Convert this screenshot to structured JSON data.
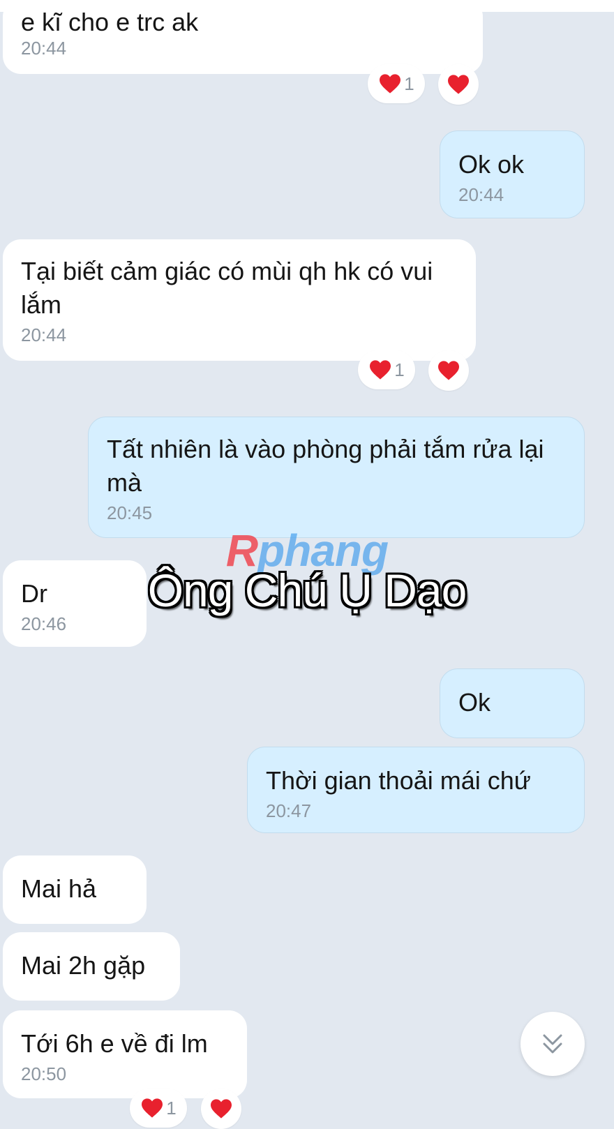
{
  "messages": [
    {
      "text": "e kĩ cho e trc ak",
      "time": "20:44"
    },
    {
      "text": "Ok ok",
      "time": "20:44"
    },
    {
      "text": "Tại biết cảm giác có mùi qh hk có vui lắm",
      "time": "20:44"
    },
    {
      "text": "Tất nhiên là vào phòng phải tắm rửa lại mà",
      "time": "20:45"
    },
    {
      "text": "Dr",
      "time": "20:46"
    },
    {
      "text": "Ok",
      "time": ""
    },
    {
      "text": "Thời gian thoải mái chứ",
      "time": "20:47"
    },
    {
      "text": "Mai hả",
      "time": ""
    },
    {
      "text": "Mai 2h gặp",
      "time": ""
    },
    {
      "text": "Tới 6h e về đi lm",
      "time": "20:50"
    }
  ],
  "reactions": {
    "count": "1",
    "icon": "heart-icon",
    "color": "#e8212e"
  },
  "watermark": {
    "brand_first": "R",
    "brand_rest": "phang",
    "title": "Ông Chú Ụ Dạo"
  },
  "scroll_button_icon": "double-chevron-down-icon",
  "colors": {
    "background": "#e2e8f0",
    "incoming": "#ffffff",
    "outgoing": "#d6efff"
  }
}
